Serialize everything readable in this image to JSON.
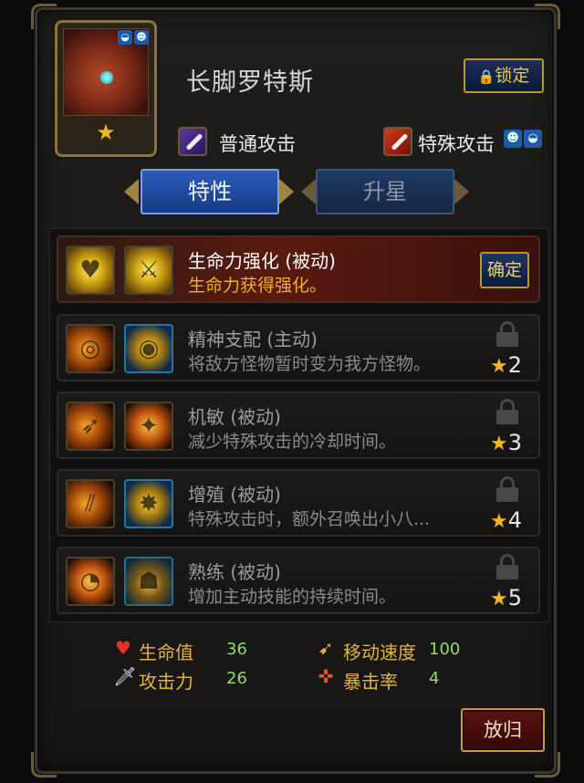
{
  "hero": {
    "name": "长脚罗特斯",
    "star": "★",
    "lock_label": "锁定"
  },
  "attacks": {
    "normal_label": "普通攻击",
    "special_label": "特殊攻击"
  },
  "tabs": [
    {
      "label": "特性",
      "active": true
    },
    {
      "label": "升星",
      "active": false
    }
  ],
  "traits": [
    {
      "title": "生命力强化 (被动)",
      "desc": "生命力获得强化。",
      "unlocked": true,
      "action_label": "确定",
      "required_stars": ""
    },
    {
      "title": "精神支配 (主动)",
      "desc": "将敌方怪物暂时变为我方怪物。",
      "unlocked": false,
      "required_stars": "2"
    },
    {
      "title": "机敏 (被动)",
      "desc": "减少特殊攻击的冷却时间。",
      "unlocked": false,
      "required_stars": "3"
    },
    {
      "title": "增殖 (被动)",
      "desc": "特殊攻击时，额外召唤出小八...",
      "unlocked": false,
      "required_stars": "4"
    },
    {
      "title": "熟练 (被动)",
      "desc": "增加主动技能的持续时间。",
      "unlocked": false,
      "required_stars": "5"
    }
  ],
  "stats": [
    {
      "label": "生命值",
      "value": "36",
      "icon": "heart-icon"
    },
    {
      "label": "攻击力",
      "value": "26",
      "icon": "sword-icon"
    },
    {
      "label": "移动速度",
      "value": "100",
      "icon": "boot-icon"
    },
    {
      "label": "暴击率",
      "value": "4",
      "icon": "crit-icon"
    }
  ],
  "return_label": "放归",
  "colors": {
    "gold": "#f4b61b",
    "stat_label": "#e2b43a",
    "stat_value": "#8fdb6a",
    "active_desc": "#f2b020",
    "tab_active": "#2c5cb8"
  }
}
